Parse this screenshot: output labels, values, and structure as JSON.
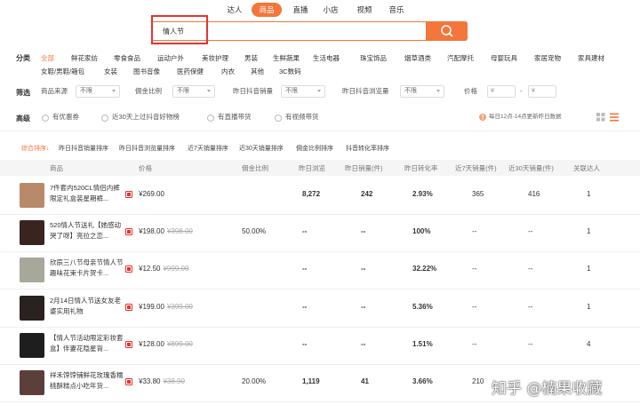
{
  "nav": {
    "tabs": [
      "达人",
      "商品",
      "直播",
      "小店",
      "视频",
      "音乐"
    ],
    "active_index": 1
  },
  "search": {
    "value": "情人节"
  },
  "filters": {
    "category_label": "分类",
    "categories_row1": [
      "全部",
      "鲜花家纺",
      "零食食品",
      "运动户外",
      "美妆护理",
      "男装",
      "生鲜蔬果",
      "生活电器",
      "珠宝饰品",
      "烟草酒类",
      "汽配摩托",
      "母婴玩具",
      "家居宠物",
      "家具建材"
    ],
    "categories_row2": [
      "女鞋/男鞋/箱包",
      "女装",
      "图书音像",
      "医药保健",
      "内衣",
      "其他",
      "3C数码"
    ],
    "screen_label": "筛选",
    "screen": [
      {
        "label": "商品来源",
        "value": "不限"
      },
      {
        "label": "佣金比例",
        "value": "不限"
      },
      {
        "label": "昨日抖音销量",
        "value": "不限"
      },
      {
        "label": "昨日抖音浏览量",
        "value": "不限"
      }
    ],
    "price_label": "价格",
    "price_from": "¥",
    "price_dash": "-",
    "price_to": "¥",
    "advanced_label": "高级",
    "advanced": [
      "有优惠券",
      "近30天上过抖音好物榜",
      "有直播带货",
      "有视频带货"
    ],
    "update_note": "每日12点-14点更新昨日数据"
  },
  "sort_tabs": [
    "综合排序",
    "昨日抖音销量排序",
    "昨日抖音浏览量排序",
    "近7天销量排序",
    "近30天销量排序",
    "佣金比例排序",
    "抖音转化率排序"
  ],
  "sort_active_arrow": "↓",
  "table": {
    "headers": [
      "商品",
      "价格",
      "佣金比例",
      "昨日浏览",
      "昨日销量(件)",
      "昨日转化率",
      "近7天销量(件)",
      "近30天销量(件)",
      "关联达人"
    ],
    "rows": [
      {
        "name": "7件套内520CL情侣内裤限定礼盒装星期裤...",
        "price": "¥269.00",
        "old_price": "",
        "commission": "",
        "views": "8,272",
        "sales": "242",
        "conversion": "2.93%",
        "sales7": "365",
        "sales30": "416",
        "influencers": "1",
        "thumb_color": "#b88a6a"
      },
      {
        "name": "520情人节送礼【她感动哭了呀】亮拉之恋...",
        "price": "¥198.00",
        "old_price": "¥398.00",
        "commission": "50.00%",
        "views": "--",
        "sales": "--",
        "conversion": "100%",
        "sales7": "--",
        "sales30": "--",
        "influencers": "1",
        "thumb_color": "#3a2420"
      },
      {
        "name": "欣辰三八节母亲节情人节趣味花束卡片贺卡...",
        "price": "¥12.50",
        "old_price": "¥999.00",
        "commission": "",
        "views": "--",
        "sales": "--",
        "conversion": "32.22%",
        "sales7": "--",
        "sales30": "--",
        "influencers": "1",
        "thumb_color": "#a8a89a"
      },
      {
        "name": "2月14日情人节送女友老婆实用礼物",
        "price": "¥199.00",
        "old_price": "¥399.00",
        "commission": "",
        "views": "--",
        "sales": "--",
        "conversion": "5.36%",
        "sales7": "--",
        "sales30": "--",
        "influencers": "1",
        "thumb_color": "#2a2220"
      },
      {
        "name": "【情人节活动限定彩妆套盒】伴妻花隐星背...",
        "price": "¥128.00",
        "old_price": "¥899.00",
        "commission": "",
        "views": "--",
        "sales": "--",
        "conversion": "1.51%",
        "sales7": "--",
        "sales30": "--",
        "influencers": "4",
        "thumb_color": "#1e1e1e"
      },
      {
        "name": "祥禾饽饽铺鲜花玫瑰香糯桃酥糕点小吃年货...",
        "price": "¥33.80",
        "old_price": "¥38.90",
        "commission": "20.00%",
        "views": "1,119",
        "sales": "41",
        "conversion": "3.66%",
        "sales7": "210",
        "sales30": "",
        "influencers": "",
        "thumb_color": "#5a4038"
      }
    ]
  },
  "watermark": "知乎 @楠果收藏",
  "colors": {
    "accent": "#f4763b",
    "highlight_box": "#e8332f"
  }
}
